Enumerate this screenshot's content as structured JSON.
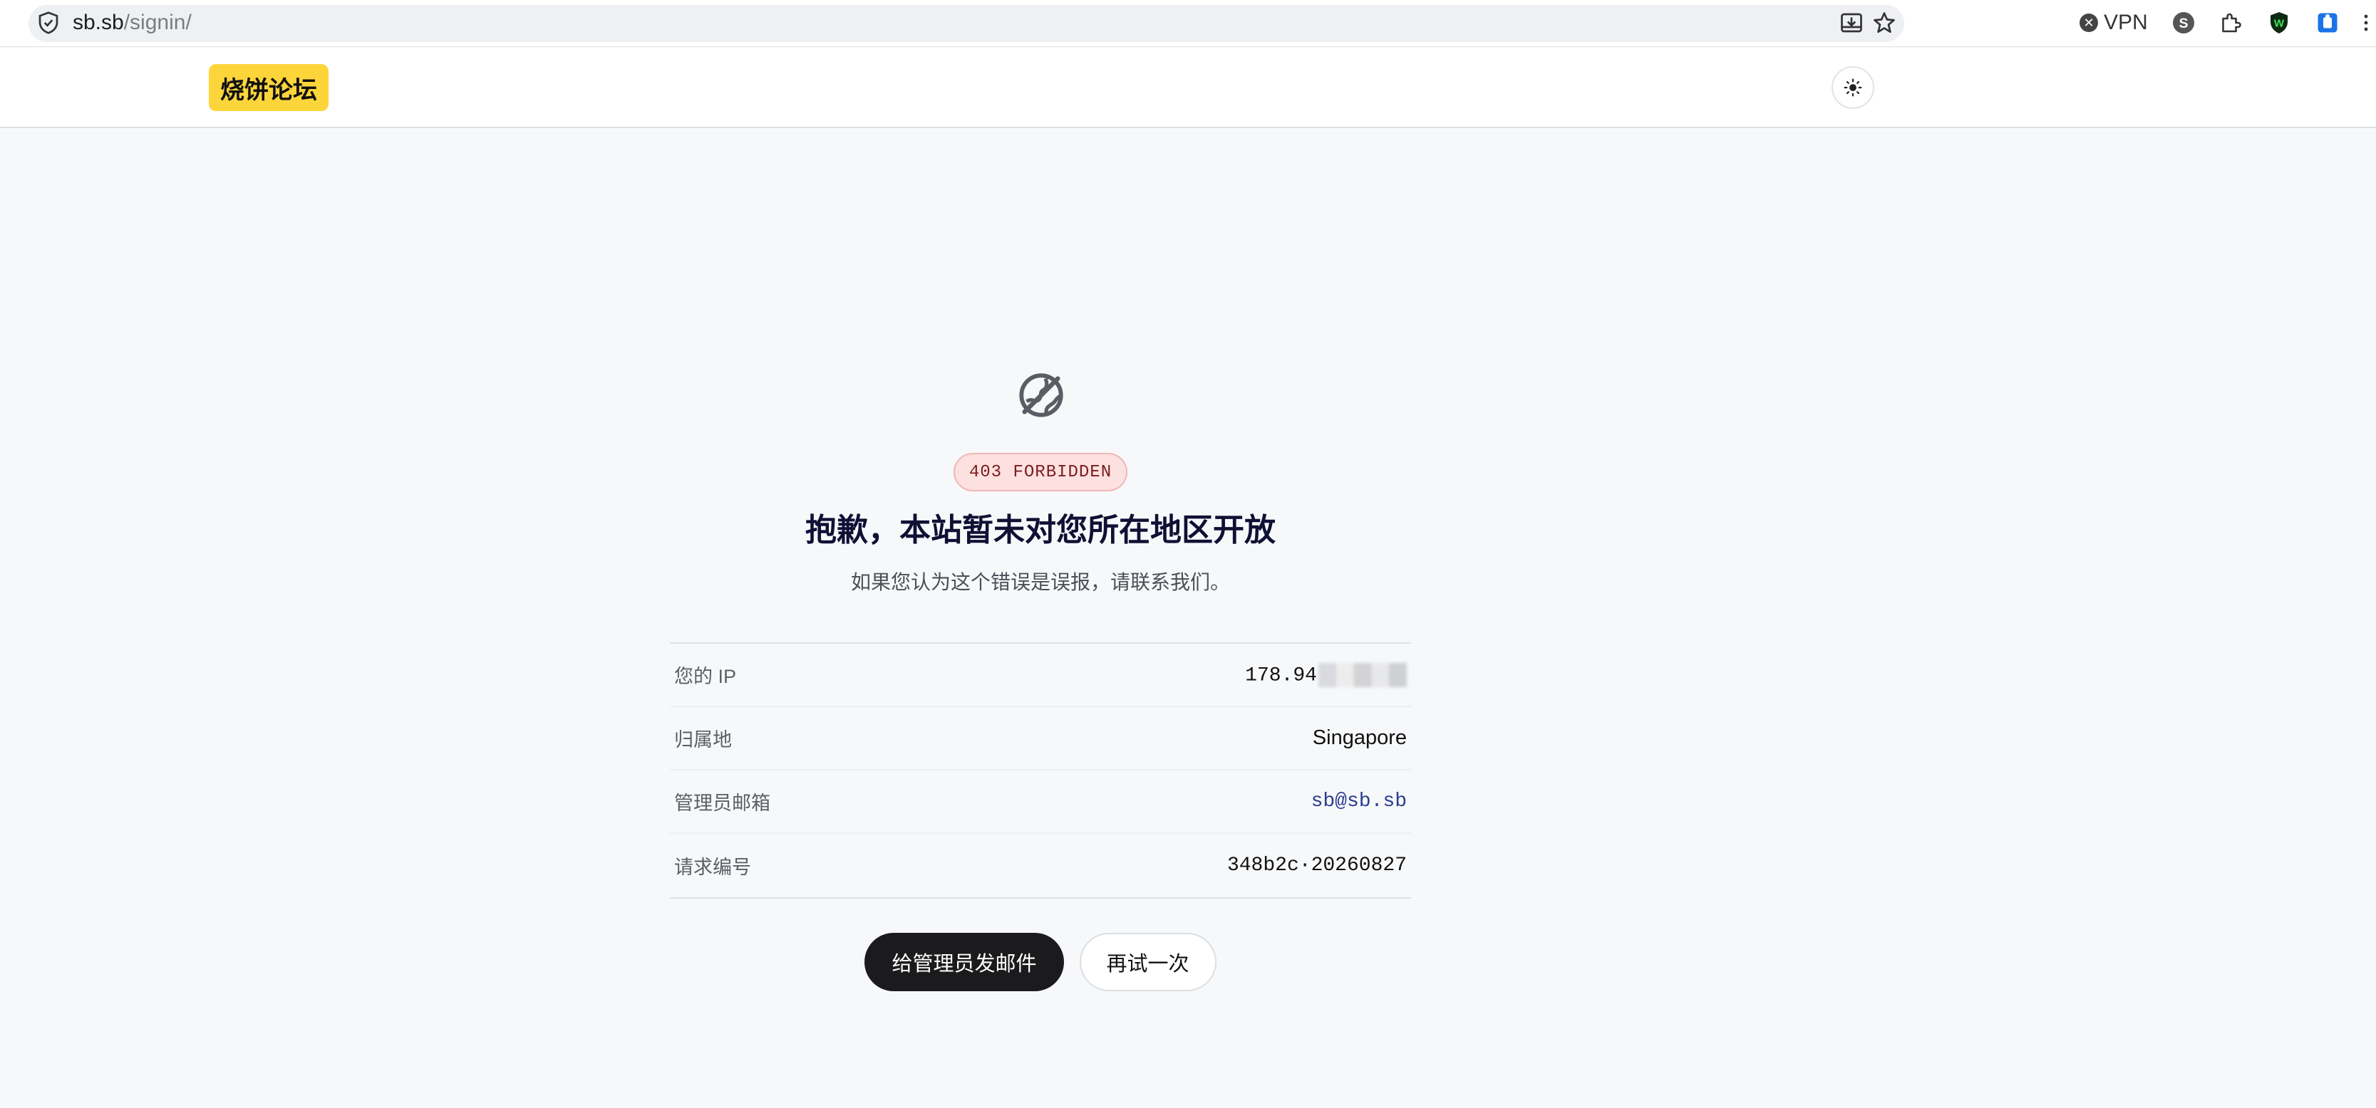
{
  "browser": {
    "url_host": "sb.sb",
    "url_path": "/signin/",
    "vpn_label": "VPN"
  },
  "site": {
    "logo_text": "烧饼论坛"
  },
  "error": {
    "badge": "403 FORBIDDEN",
    "title": "抱歉，本站暂未对您所在地区开放",
    "subtitle": "如果您认为这个错误是误报，请联系我们。"
  },
  "info_rows": [
    {
      "label": "您的 IP",
      "value": "178.94"
    },
    {
      "label": "归属地",
      "value": "Singapore"
    },
    {
      "label": "管理员邮箱",
      "value": "sb@sb.sb"
    },
    {
      "label": "请求编号",
      "value": "348b2c·20260827"
    }
  ],
  "actions": {
    "email_admin": "给管理员发邮件",
    "retry": "再试一次"
  },
  "colors": {
    "logo_bg": "#fcd53a",
    "badge_bg": "#fde0e0",
    "title": "#0f1034",
    "primary_button": "#1b1b1d"
  }
}
